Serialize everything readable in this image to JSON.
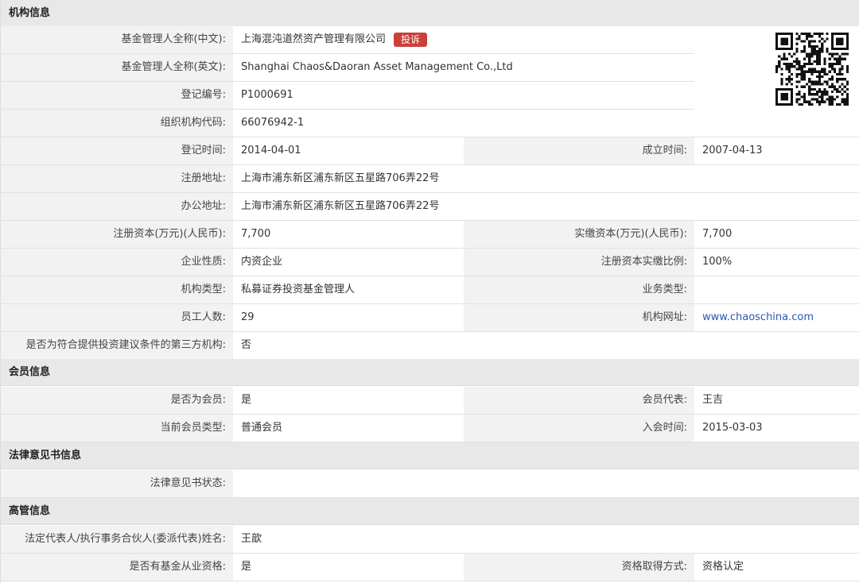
{
  "sections": {
    "org": "机构信息",
    "member": "会员信息",
    "legal": "法律意见书信息",
    "exec": "高管信息"
  },
  "org": {
    "name_cn_label": "基金管理人全称(中文):",
    "name_cn_value": "上海混沌道然资产管理有限公司",
    "complaint_button": "投诉",
    "name_en_label": "基金管理人全称(英文):",
    "name_en_value": "Shanghai Chaos&Daoran Asset Management Co.,Ltd",
    "reg_no_label": "登记编号:",
    "reg_no_value": "P1000691",
    "org_code_label": "组织机构代码:",
    "org_code_value": "66076942-1",
    "reg_date_label": "登记时间:",
    "reg_date_value": "2014-04-01",
    "found_date_label": "成立时间:",
    "found_date_value": "2007-04-13",
    "reg_addr_label": "注册地址:",
    "reg_addr_value": "上海市浦东新区浦东新区五星路706弄22号",
    "office_addr_label": "办公地址:",
    "office_addr_value": "上海市浦东新区浦东新区五星路706弄22号",
    "reg_capital_label": "注册资本(万元)(人民币):",
    "reg_capital_value": "7,700",
    "paid_capital_label": "实缴资本(万元)(人民币):",
    "paid_capital_value": "7,700",
    "nature_label": "企业性质:",
    "nature_value": "内资企业",
    "paid_ratio_label": "注册资本实缴比例:",
    "paid_ratio_value": "100%",
    "type_label": "机构类型:",
    "type_value": "私募证券投资基金管理人",
    "biz_type_label": "业务类型:",
    "biz_type_value": "",
    "staff_label": "员工人数:",
    "staff_value": "29",
    "website_label": "机构网址:",
    "website_value": "www.chaoschina.com",
    "third_party_label": "是否为符合提供投资建议条件的第三方机构:",
    "third_party_value": "否",
    "qr_icon": "qr-code-icon"
  },
  "member": {
    "is_member_label": "是否为会员:",
    "is_member_value": "是",
    "rep_label": "会员代表:",
    "rep_value": "王吉",
    "member_type_label": "当前会员类型:",
    "member_type_value": "普通会员",
    "join_date_label": "入会时间:",
    "join_date_value": "2015-03-03"
  },
  "legal": {
    "status_label": "法律意见书状态:",
    "status_value": ""
  },
  "exec": {
    "legal_rep_label": "法定代表人/执行事务合伙人(委派代表)姓名:",
    "legal_rep_value": "王歆",
    "qualified_label": "是否有基金从业资格:",
    "qualified_value": "是",
    "qual_method_label": "资格取得方式:",
    "qual_method_value": "资格认定"
  },
  "colors": {
    "section_bg": "#e8e8e8",
    "label_bg": "#f2f2f2",
    "badge": "#c9403a",
    "link": "#2a59b5"
  }
}
